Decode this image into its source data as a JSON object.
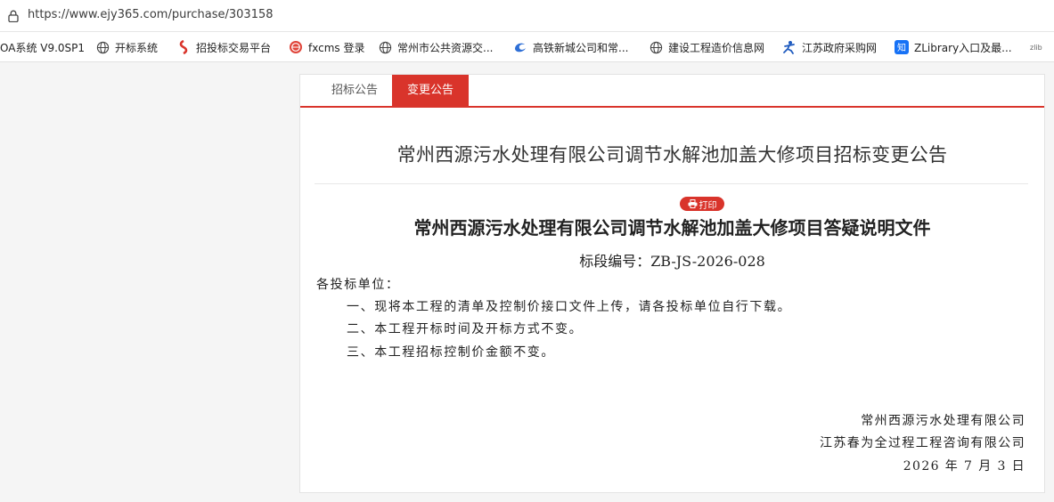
{
  "browser": {
    "url": "https://www.ejy365.com/purchase/303158"
  },
  "bookmarks": [
    {
      "label": "OA系统 V9.0SP1",
      "icon": "oa-icon"
    },
    {
      "label": "开标系统",
      "icon": "globe-icon"
    },
    {
      "label": "招投标交易平台",
      "icon": "red-logo-icon"
    },
    {
      "label": "fxcms 登录",
      "icon": "red-circle-icon"
    },
    {
      "label": "常州市公共资源交...",
      "icon": "globe-icon"
    },
    {
      "label": "高铁新城公司和常...",
      "icon": "blue-swirl-icon"
    },
    {
      "label": "建设工程造价信息网",
      "icon": "globe-icon"
    },
    {
      "label": "江苏政府采购网",
      "icon": "blue-figure-icon"
    },
    {
      "label": "ZLibrary入口及最...",
      "icon": "zhi-icon"
    },
    {
      "label": "zlib",
      "icon": "zlib-icon"
    }
  ],
  "tabs": [
    {
      "label": "招标公告",
      "active": false
    },
    {
      "label": "变更公告",
      "active": true
    }
  ],
  "notice": {
    "title": "常州西源污水处理有限公司调节水解池加盖大修项目招标变更公告",
    "print_label": "打印",
    "doc_title": "常州西源污水处理有限公司调节水解池加盖大修项目答疑说明文件",
    "section_no": "标段编号：ZB-JS-2026-028",
    "greeting": "各投标单位：",
    "items": [
      "一、现将本工程的清单及控制价接口文件上传，请各投标单位自行下载。",
      "二、本工程开标时间及开标方式不变。",
      "三、本工程招标控制价金额不变。"
    ],
    "signature": [
      "常州西源污水处理有限公司",
      "江苏春为全过程工程咨询有限公司",
      "2026 年 7 月 3 日"
    ]
  },
  "colors": {
    "accent": "#d9342b",
    "background": "#f5f5f5"
  }
}
